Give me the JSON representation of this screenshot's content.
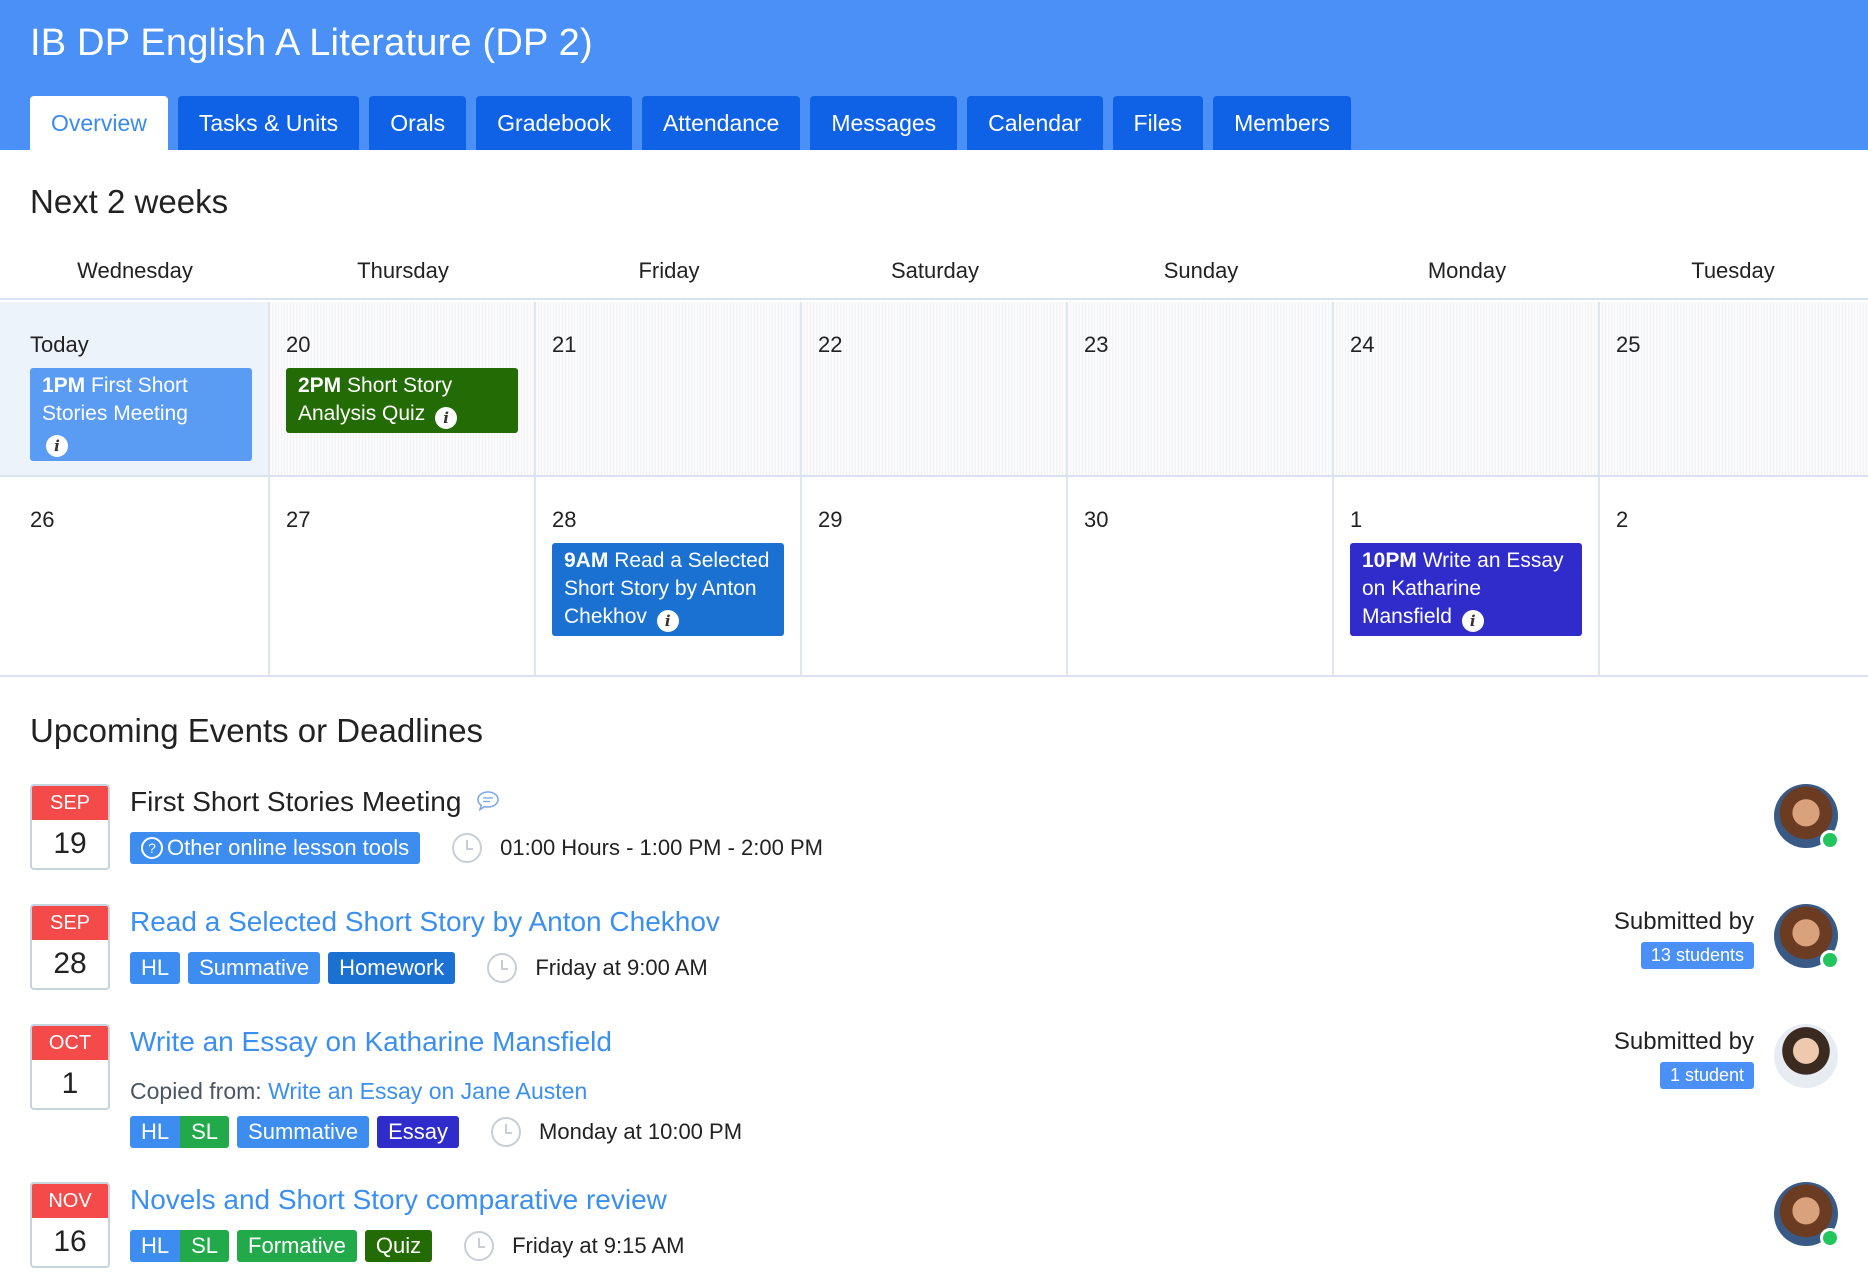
{
  "header": {
    "title": "IB DP English A Literature (DP 2)",
    "tabs": [
      "Overview",
      "Tasks & Units",
      "Orals",
      "Gradebook",
      "Attendance",
      "Messages",
      "Calendar",
      "Files",
      "Members"
    ],
    "active_tab": "Overview"
  },
  "next_weeks": {
    "title": "Next 2 weeks",
    "weekdays": [
      "Wednesday",
      "Thursday",
      "Friday",
      "Saturday",
      "Sunday",
      "Monday",
      "Tuesday"
    ],
    "week1": [
      "Today",
      "20",
      "21",
      "22",
      "23",
      "24",
      "25"
    ],
    "week2": [
      "26",
      "27",
      "28",
      "29",
      "30",
      "1",
      "2"
    ],
    "events": {
      "today": {
        "time": "1PM",
        "title": "First Short Stories Meeting"
      },
      "d20": {
        "time": "2PM",
        "title": "Short Story Analysis Quiz"
      },
      "d28": {
        "time": "9AM",
        "title": "Read a Selected Short Story by Anton Chekhov"
      },
      "d1": {
        "time": "10PM",
        "title": "Write an Essay on Katharine Mansfield"
      }
    }
  },
  "upcoming": {
    "title": "Upcoming Events or Deadlines",
    "items": [
      {
        "month": "SEP",
        "day": "19",
        "title": "First Short Stories Meeting",
        "tool": "Other online lesson tools",
        "time": "01:00 Hours - 1:00 PM - 2:00 PM"
      },
      {
        "month": "SEP",
        "day": "28",
        "title": "Read a Selected Short Story by Anton Chekhov",
        "tags": [
          "HL",
          "Summative",
          "Homework"
        ],
        "time": "Friday at 9:00 AM",
        "submitted_label": "Submitted by",
        "submitted_count": "13 students"
      },
      {
        "month": "OCT",
        "day": "1",
        "title": "Write an Essay on Katharine Mansfield",
        "copied_label": "Copied from:",
        "copied_link": "Write an Essay on Jane Austen",
        "tags": [
          "HL",
          "SL",
          "Summative",
          "Essay"
        ],
        "time": "Monday at 10:00 PM",
        "submitted_label": "Submitted by",
        "submitted_count": "1 student"
      },
      {
        "month": "NOV",
        "day": "16",
        "title": "Novels and Short Story comparative review",
        "tags": [
          "HL",
          "SL",
          "Formative",
          "Quiz"
        ],
        "time": "Friday at 9:15 AM"
      }
    ]
  },
  "colors": {
    "header_bg": "#4a90f7",
    "tab_bg": "#0f62e6",
    "link": "#3a8ff0",
    "calendar_month": "#f44a4a",
    "online": "#22c55e"
  },
  "icons": [
    "info-icon",
    "comment-icon",
    "question-icon",
    "clock-icon",
    "avatar",
    "online-indicator"
  ]
}
